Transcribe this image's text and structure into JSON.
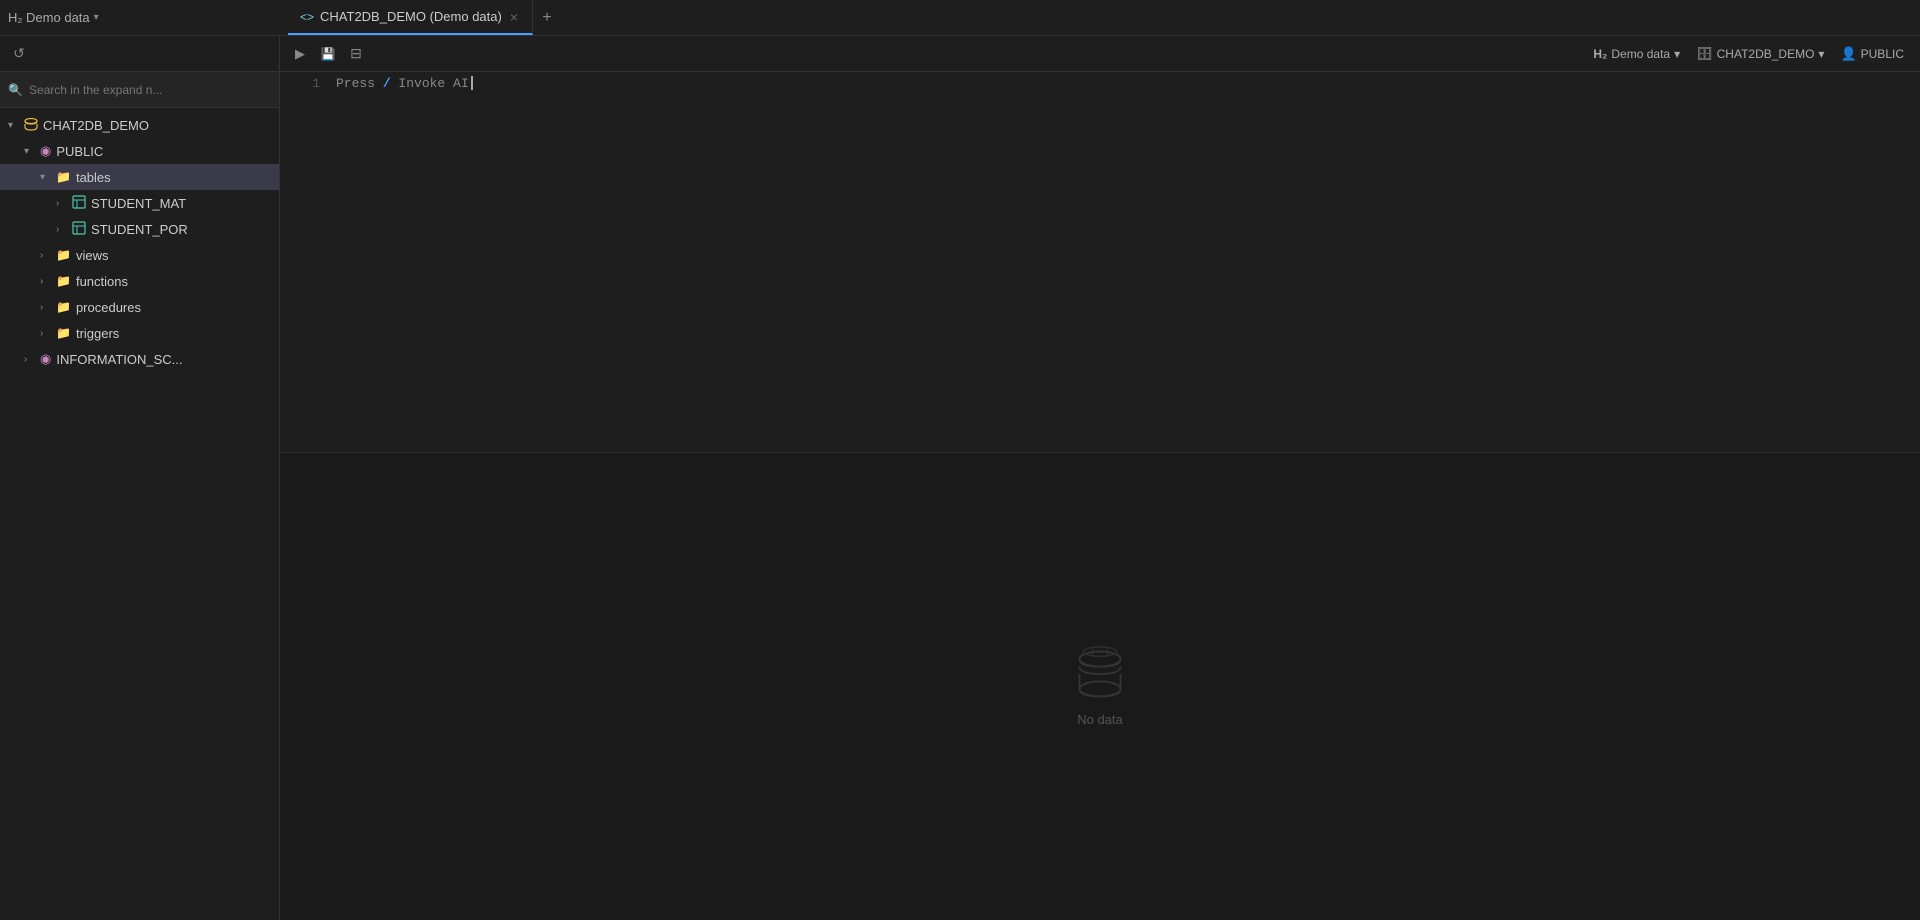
{
  "titleBar": {
    "appTitle": "H₂ Demo data",
    "chevron": "▾",
    "tab": {
      "icon": "<>",
      "label": "CHAT2DB_DEMO (Demo data)",
      "closeBtn": "×"
    },
    "addTabBtn": "+"
  },
  "topBar": {
    "runBtn": "▶",
    "saveBtn": "💾",
    "formatBtn": "⊞",
    "connections": [
      {
        "icon": "H₂",
        "label": "Demo data",
        "chevron": "▾"
      },
      {
        "icon": "🗄",
        "label": "CHAT2DB_DEMO",
        "chevron": "▾"
      },
      {
        "icon": "👤",
        "label": "PUBLIC"
      }
    ]
  },
  "sidebar": {
    "refreshIcon": "↺",
    "search": {
      "placeholder": "Search in the expand n...",
      "icon": "⚲"
    },
    "tree": [
      {
        "id": "chat2db",
        "label": "CHAT2DB_DEMO",
        "type": "db",
        "indent": 0,
        "expanded": true,
        "chevron": "▾"
      },
      {
        "id": "public",
        "label": "PUBLIC",
        "type": "schema",
        "indent": 1,
        "expanded": true,
        "chevron": "▾"
      },
      {
        "id": "tables",
        "label": "tables",
        "type": "folder",
        "indent": 2,
        "expanded": true,
        "chevron": "▾",
        "selected": true
      },
      {
        "id": "student_mat",
        "label": "STUDENT_MAT",
        "type": "table",
        "indent": 3,
        "expanded": false,
        "chevron": "›"
      },
      {
        "id": "student_por",
        "label": "STUDENT_POR",
        "type": "table",
        "indent": 3,
        "expanded": false,
        "chevron": "›"
      },
      {
        "id": "views",
        "label": "views",
        "type": "folder",
        "indent": 2,
        "expanded": false,
        "chevron": "›"
      },
      {
        "id": "functions",
        "label": "functions",
        "type": "folder",
        "indent": 2,
        "expanded": false,
        "chevron": "›"
      },
      {
        "id": "procedures",
        "label": "procedures",
        "type": "folder",
        "indent": 2,
        "expanded": false,
        "chevron": "›"
      },
      {
        "id": "triggers",
        "label": "triggers",
        "type": "folder",
        "indent": 2,
        "expanded": false,
        "chevron": "›"
      },
      {
        "id": "information_sc",
        "label": "INFORMATION_SC...",
        "type": "schema",
        "indent": 1,
        "expanded": false,
        "chevron": "›"
      }
    ]
  },
  "editor": {
    "lines": [
      {
        "num": "1",
        "parts": [
          {
            "text": "Press ",
            "class": "kw-press"
          },
          {
            "text": "/",
            "class": "kw-slash"
          },
          {
            "text": " Invoke AI",
            "class": "kw-invoke"
          }
        ]
      }
    ]
  },
  "results": {
    "noDataText": "No data"
  }
}
